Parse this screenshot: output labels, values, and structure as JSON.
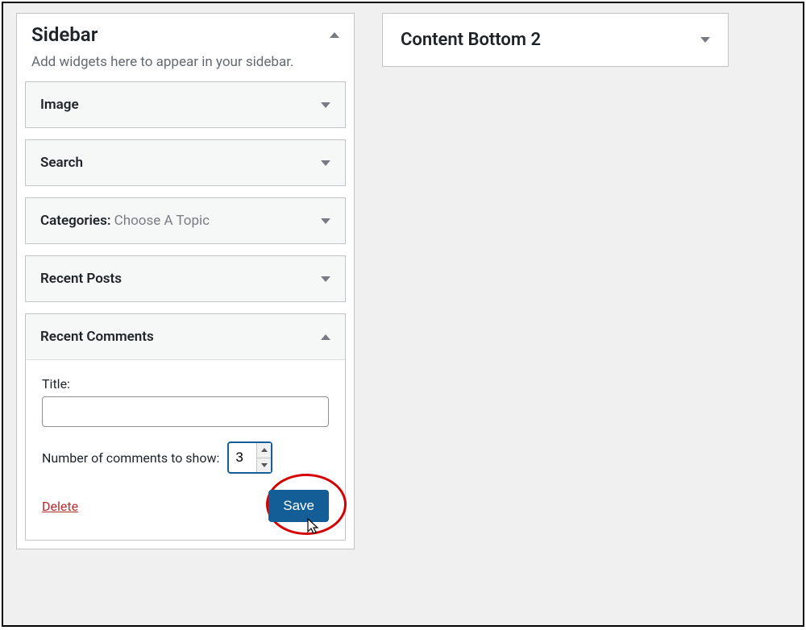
{
  "sidebar_area": {
    "title": "Sidebar",
    "description": "Add widgets here to appear in your sidebar.",
    "widgets": [
      {
        "title": "Image",
        "subtitle": ""
      },
      {
        "title": "Search",
        "subtitle": ""
      },
      {
        "title": "Categories:",
        "subtitle": " Choose A Topic"
      },
      {
        "title": "Recent Posts",
        "subtitle": ""
      }
    ],
    "open_widget": {
      "title": "Recent Comments",
      "title_field_label": "Title:",
      "title_field_value": "",
      "number_label": "Number of comments to show:",
      "number_value": "3",
      "delete_label": "Delete",
      "save_label": "Save"
    }
  },
  "content_bottom": {
    "title": "Content Bottom 2"
  }
}
